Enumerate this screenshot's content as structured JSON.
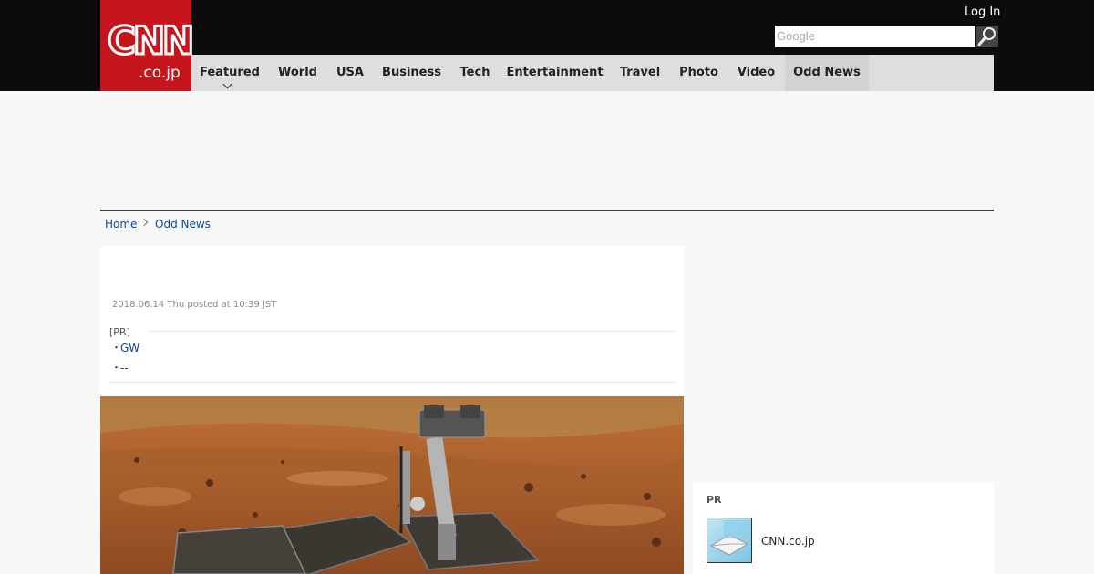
{
  "header": {
    "logo_main": "CNN",
    "logo_sub": ".co.jp",
    "login_label": "Log In",
    "search_placeholder": "Google",
    "colors": {
      "brand": "#c4161c",
      "topbar": "#0c0c0c",
      "nav": "#dedede",
      "link": "#0c4b8e"
    }
  },
  "nav": {
    "items": [
      {
        "label": "Featured"
      },
      {
        "label": "World"
      },
      {
        "label": "USA"
      },
      {
        "label": "Business"
      },
      {
        "label": "Tech"
      },
      {
        "label": "Entertainment"
      },
      {
        "label": "Travel"
      },
      {
        "label": "Photo"
      },
      {
        "label": "Video"
      },
      {
        "label": "Odd News"
      }
    ],
    "active": "Odd News"
  },
  "breadcrumb": {
    "home": "Home",
    "current": "Odd News"
  },
  "article": {
    "date": "2018.06.14 Thu posted at 10:39 JST",
    "pr_label": "[PR]",
    "pr_links": [
      {
        "bullet": "・",
        "text": "GW"
      },
      {
        "bullet": "・",
        "text": "--"
      }
    ],
    "photo_alt_icon": "mars-rover-image"
  },
  "sidebar_pr": {
    "title": "PR",
    "item_text": "CNN.co.jp"
  }
}
